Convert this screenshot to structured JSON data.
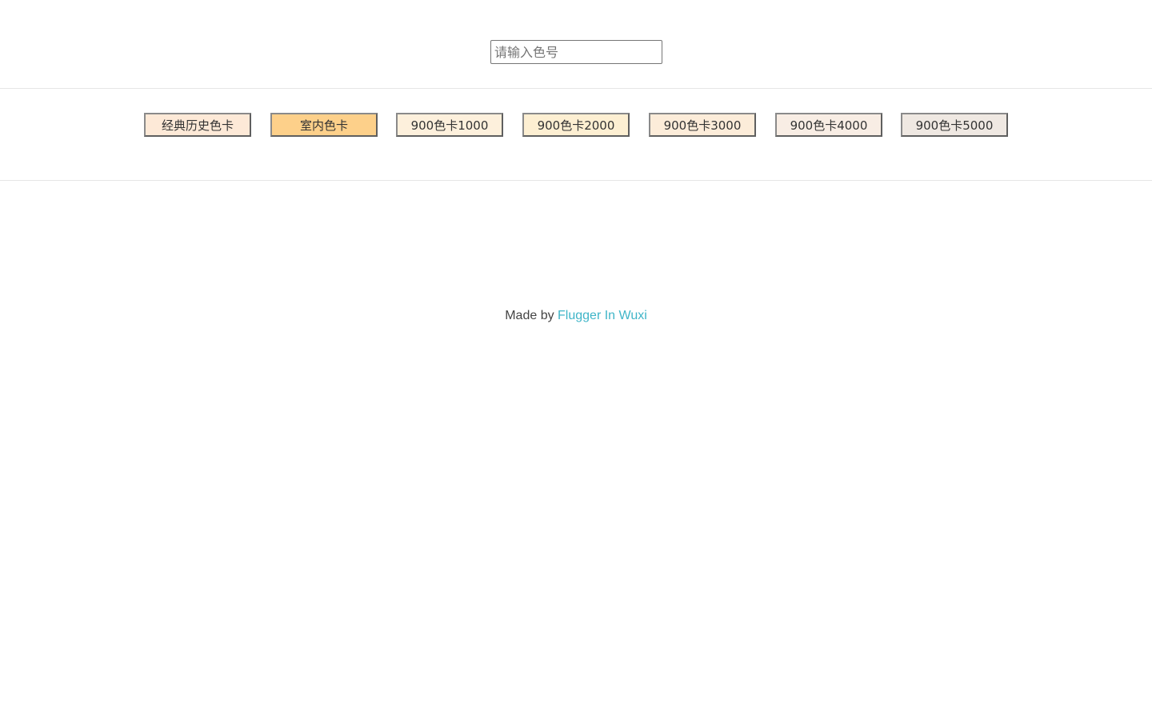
{
  "search": {
    "placeholder": "请输入色号",
    "value": ""
  },
  "tabs": [
    {
      "label": "经典历史色卡",
      "color": "#fde9d7",
      "selected": false
    },
    {
      "label": "室内色卡",
      "color": "#fdd08a",
      "selected": true
    },
    {
      "label": "900色卡1000",
      "color": "#fdf0dc",
      "selected": false
    },
    {
      "label": "900色卡2000",
      "color": "#fdefd2",
      "selected": false
    },
    {
      "label": "900色卡3000",
      "color": "#fcecd9",
      "selected": false
    },
    {
      "label": "900色卡4000",
      "color": "#f8ede4",
      "selected": false
    },
    {
      "label": "900色卡5000",
      "color": "#efe8e2",
      "selected": false
    }
  ],
  "footer": {
    "prefix": "Made by ",
    "link_text": "Flugger In Wuxi",
    "link_color": "#3fb5c8"
  }
}
